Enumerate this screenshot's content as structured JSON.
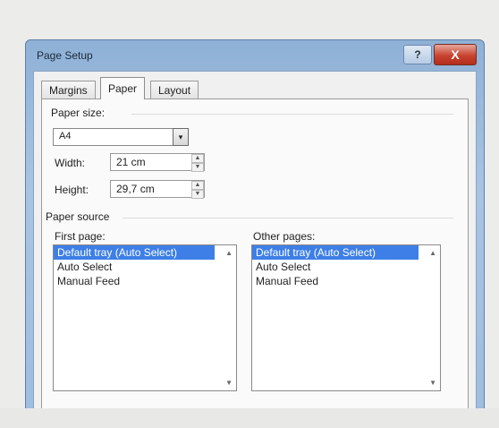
{
  "window": {
    "title": "Page Setup",
    "help_glyph": "?",
    "close_glyph": "X"
  },
  "tabs": [
    {
      "label": "Margins"
    },
    {
      "label": "Paper"
    },
    {
      "label": "Layout"
    }
  ],
  "paper_size": {
    "label": "Paper size:",
    "value": "A4",
    "dropdown_icon": "▾",
    "width_label": "Width:",
    "width_value": "21 cm",
    "height_label": "Height:",
    "height_value": "29,7 cm"
  },
  "paper_source": {
    "label": "Paper source",
    "first_page": {
      "label": "First page:",
      "items": [
        "Default tray (Auto Select)",
        "Auto Select",
        "Manual Feed"
      ]
    },
    "other_pages": {
      "label": "Other pages:",
      "items": [
        "Default tray (Auto Select)",
        "Auto Select",
        "Manual Feed"
      ]
    }
  }
}
